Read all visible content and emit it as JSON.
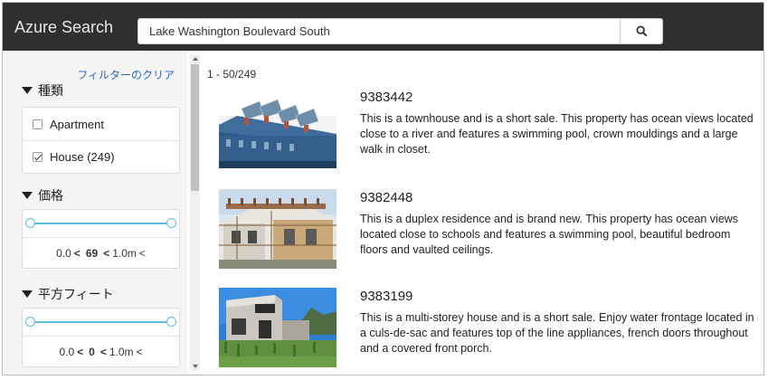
{
  "header": {
    "brand": "Azure Search",
    "search_value": "Lake Washington Boulevard South"
  },
  "sidebar": {
    "clear_filters": "フィルターのクリア",
    "type_facet": {
      "title": "種類",
      "options": [
        {
          "label": "Apartment",
          "checked": false
        },
        {
          "label": "House (249)",
          "checked": true
        }
      ]
    },
    "price_facet": {
      "title": "価格",
      "min": "0.0",
      "value": "69",
      "max": "1.0m",
      "lt1": "<",
      "lt2": "<",
      "lt3": "<"
    },
    "sqft_facet": {
      "title": "平方フィート",
      "min": "0.0",
      "value": "0",
      "max": "1.0m",
      "lt1": "<",
      "lt2": "<",
      "lt3": "<"
    }
  },
  "results": {
    "count": "1 - 50/249",
    "items": [
      {
        "id": "9383442",
        "description": "This is a townhouse and is a short sale. This property has ocean views located close to a river and features a swimming pool, crown mouldings and a large walk in closet."
      },
      {
        "id": "9382448",
        "description": "This is a duplex residence and is brand new. This property has ocean views located close to schools and features a swimming pool, beautiful bedroom floors and vaulted ceilings."
      },
      {
        "id": "9383199",
        "description": "This is a multi-storey house and is a short sale. Enjoy water frontage located in a culs-de-sac and features top of the line appliances, french doors throughout and a covered front porch."
      }
    ]
  },
  "icons": {
    "search": "search-icon",
    "triangle": "triangle-down-icon"
  },
  "colors": {
    "topbar": "#2f2f2f",
    "accent": "#5bbde0",
    "link": "#2a6ab3"
  }
}
